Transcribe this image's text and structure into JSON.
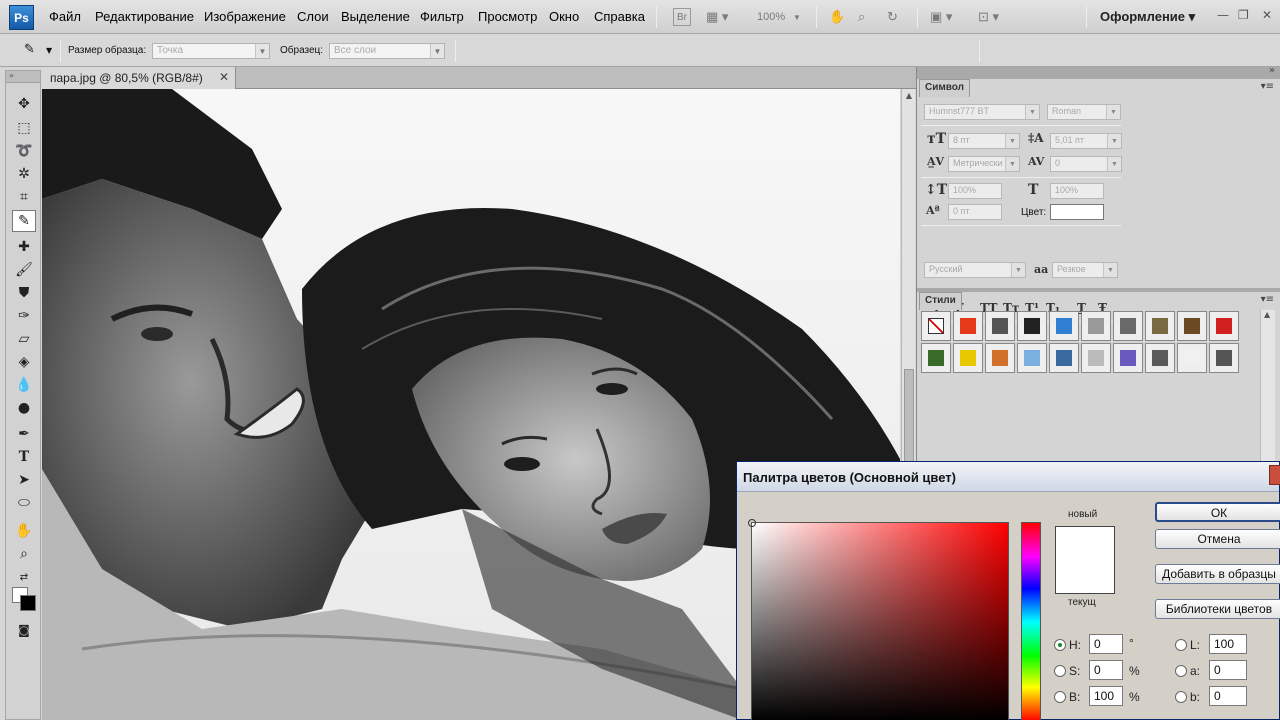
{
  "app": {
    "logo": "Ps"
  },
  "menu": [
    "Файл",
    "Редактирование",
    "Изображение",
    "Слои",
    "Выделение",
    "Фильтр",
    "Просмотр",
    "Окно",
    "Справка"
  ],
  "appbar": {
    "bridge": "Br",
    "zoom": "100%",
    "workspace": "Оформление ▾"
  },
  "options": {
    "sample_size_label": "Размер образца:",
    "sample_size_value": "Точка",
    "sample_label": "Образец:",
    "sample_value": "Все слои"
  },
  "document": {
    "tab_title": "пара.jpg @ 80,5% (RGB/8#)"
  },
  "character_panel": {
    "tab": "Символ",
    "font_family": "Humnst777 BT",
    "font_style": "Roman",
    "font_size": "8 пт",
    "leading": "5,01 пт",
    "kerning": "Метрически",
    "tracking": "0",
    "vertical_scale": "100%",
    "horizontal_scale": "100%",
    "baseline_shift": "0 пт",
    "color_label": "Цвет:",
    "language": "Русский",
    "antialias_label": "aa",
    "antialias": "Резкое",
    "format_buttons": [
      "T",
      "T",
      "TT",
      "Tт",
      "T¹",
      "T₁",
      "T",
      "Ŧ"
    ]
  },
  "styles_panel": {
    "tab": "Стили",
    "swatch_colors": [
      "#ffffff",
      "#e53a1a",
      "#555555",
      "#222222",
      "#2f7fd3",
      "#9a9a9a",
      "#6a6a6a",
      "#7a6a42",
      "#6a4a22",
      "#d02020",
      "#3a6a2a",
      "#e8c800",
      "#d0702a",
      "#7ab0e0",
      "#3a6aa0",
      "#bbbbbb",
      "#6a5ac0",
      "#5a5a5a",
      "#f0f0f0",
      "#555555"
    ]
  },
  "color_picker": {
    "title": "Палитра цветов (Основной цвет)",
    "new_label": "новый",
    "current_label": "текущ",
    "ok": "ОК",
    "cancel": "Отмена",
    "add_to_swatches": "Добавить в образцы",
    "color_libraries": "Библиотеки цветов",
    "h_label": "H:",
    "h_value": "0",
    "h_unit": "°",
    "s_label": "S:",
    "s_value": "0",
    "s_unit": "%",
    "b_label": "B:",
    "b_value": "100",
    "b_unit": "%",
    "l_label": "L:",
    "l_value": "100",
    "a_label": "a:",
    "a_value": "0",
    "bb_label": "b:",
    "bb_value": "0",
    "new_color": "#ffffff"
  }
}
